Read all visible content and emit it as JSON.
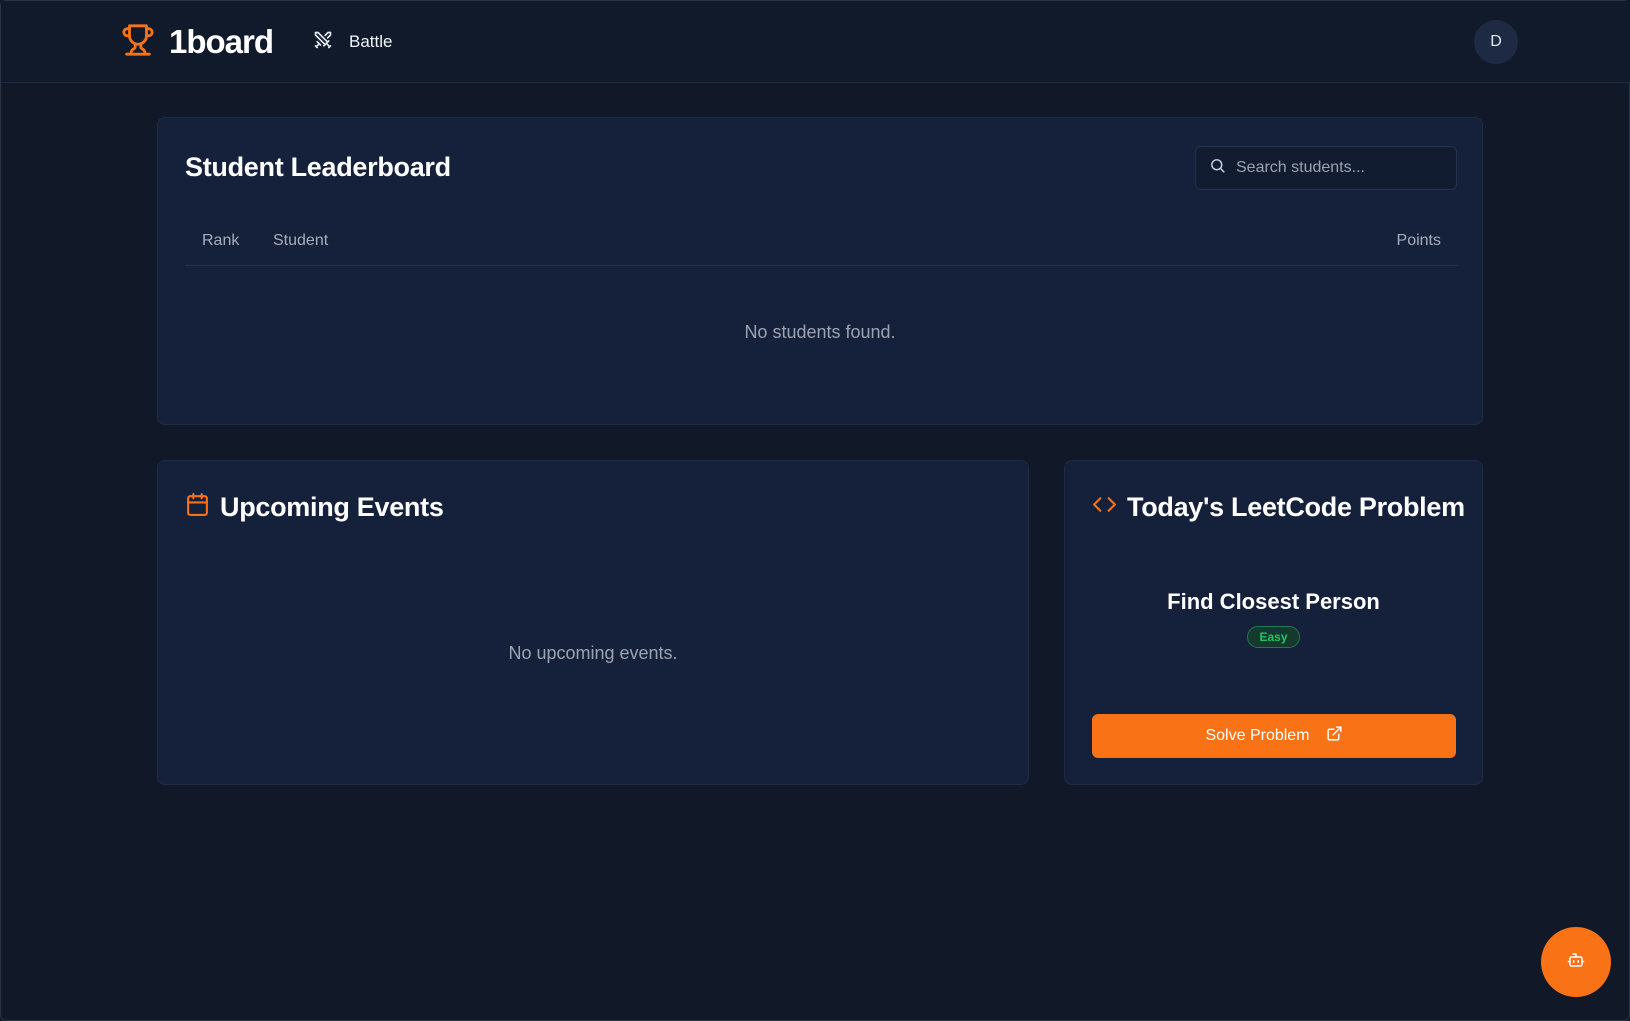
{
  "header": {
    "brand_name": "1board",
    "nav": [
      {
        "label": "Battle",
        "icon": "crossed-swords-icon"
      }
    ],
    "avatar_initial": "D"
  },
  "leaderboard": {
    "title": "Student Leaderboard",
    "search_placeholder": "Search students...",
    "columns": [
      "Rank",
      "Student",
      "Points"
    ],
    "empty_message": "No students found."
  },
  "events": {
    "title": "Upcoming Events",
    "icon": "calendar-icon",
    "empty_message": "No upcoming events."
  },
  "leetcode": {
    "title": "Today's LeetCode Problem",
    "icon": "code-icon",
    "problem_name": "Find Closest Person",
    "difficulty": "Easy",
    "solve_label": "Solve Problem"
  },
  "fab": {
    "icon": "bot-icon"
  },
  "colors": {
    "accent": "#f97316",
    "background": "#111827",
    "card": "#15203a",
    "easy": "#22c55e"
  }
}
